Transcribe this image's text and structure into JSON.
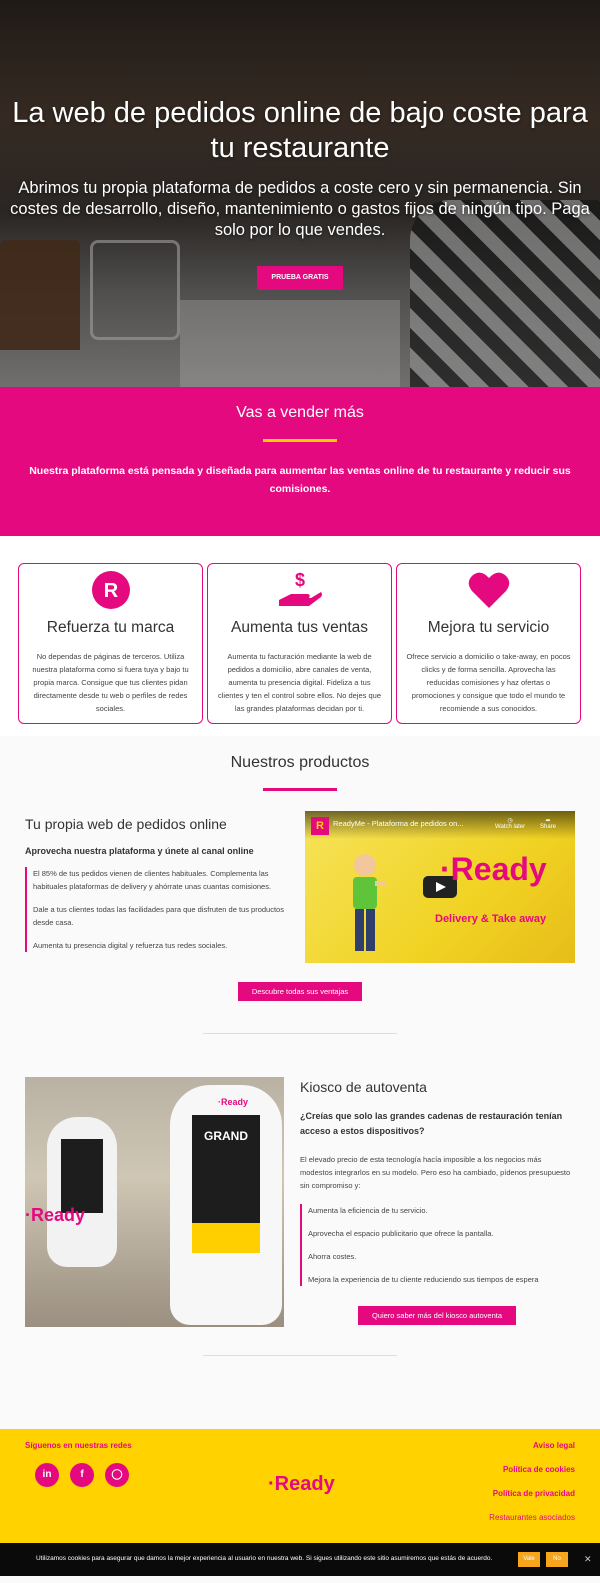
{
  "hero": {
    "title": "La web de pedidos online de bajo coste para tu restaurante",
    "subtitle": "Abrimos tu propia plataforma de pedidos a coste cero y sin permanencia. Sin costes de desarrollo, diseño, mantenimiento o gastos fijos de ningún tipo. Paga solo por lo que vendes.",
    "cta": "PRUEBA GRATIS"
  },
  "sell": {
    "title": "Vas a vender más",
    "text": "Nuestra plataforma está pensada y diseñada para aumentar las ventas online de tu restaurante y reducir sus comisiones."
  },
  "features": [
    {
      "icon": "r-logo-icon",
      "title": "Refuerza tu marca",
      "text": "No dependas de páginas de terceros. Utiliza nuestra plataforma como si fuera tuya y bajo tu propia marca. Consigue que tus clientes pidan directamente desde tu web o perfiles de redes sociales."
    },
    {
      "icon": "money-hand-icon",
      "title": "Aumenta tus ventas",
      "text": "Aumenta tu facturación mediante la web de pedidos a domicilio, abre canales de venta, aumenta tu presencia digital. Fideliza a tus clientes y ten el control sobre ellos. No dejes que las grandes plataformas decidan por ti."
    },
    {
      "icon": "heart-icon",
      "title": "Mejora tu servicio",
      "text": "Ofrece servicio a domicilio o take-away, en pocos clicks y de forma sencilla. Aprovecha las reducidas comisiones y haz ofertas o promociones y consigue que todo el mundo te recomiende a sus conocidos."
    }
  ],
  "products": {
    "title": "Nuestros productos",
    "p1": {
      "title": "Tu propia web de pedidos online",
      "subtitle": "Aprovecha nuestra plataforma y únete al canal online",
      "paragraphs": [
        "El 85% de tus pedidos vienen de clientes habituales. Complementa las habituales plataformas de delivery y ahórrate unas cuantas comisiones.",
        "Dale a tus clientes todas las facilidades para que disfruten de tus productos desde casa.",
        "Aumenta tu presencia digital y refuerza tus redes sociales."
      ],
      "button": "Descubre todas sus ventajas",
      "video": {
        "title": "ReadyMe - Plataforma de pedidos on...",
        "watch_later": "Watch later",
        "share": "Share",
        "brand": "·Ready",
        "tagline": "Delivery & Take away"
      }
    },
    "p2": {
      "title": "Kiosco de autoventa",
      "subtitle": "¿Creías que solo las grandes cadenas de restauración tenían acceso a estos dispositivos?",
      "text": "El elevado precio de esta tecnología hacía imposible a los negocios más modestos integrarlos en su modelo. Pero eso ha cambiado, pídenos presupuesto sin compromiso y:",
      "items": [
        "Aumenta la eficiencia de tu servicio.",
        "Aprovecha el espacio publicitario que ofrece la pantalla.",
        "Ahorra costes.",
        "Mejora la experiencia de tu cliente reduciendo sus tiempos de espera"
      ],
      "button": "Quiero saber más del kiosco autoventa",
      "kiosk_brand": "·Ready",
      "screen_text": "GRAND"
    }
  },
  "footer": {
    "follow": "Síguenos en nuestras redes",
    "logo": "·Ready",
    "links": [
      "Aviso legal",
      "Política de cookies",
      "Política de privacidad",
      "Restaurantes asociados"
    ]
  },
  "cookie": {
    "text": "Utilizamos cookies para asegurar que damos la mejor experiencia al usuario en nuestra web. Si sigues utilizando este sitio asumiremos que estás de acuerdo.",
    "yes": "Vale",
    "no": "No"
  },
  "colors": {
    "brand": "#e5097f",
    "accent": "#ffd200"
  }
}
